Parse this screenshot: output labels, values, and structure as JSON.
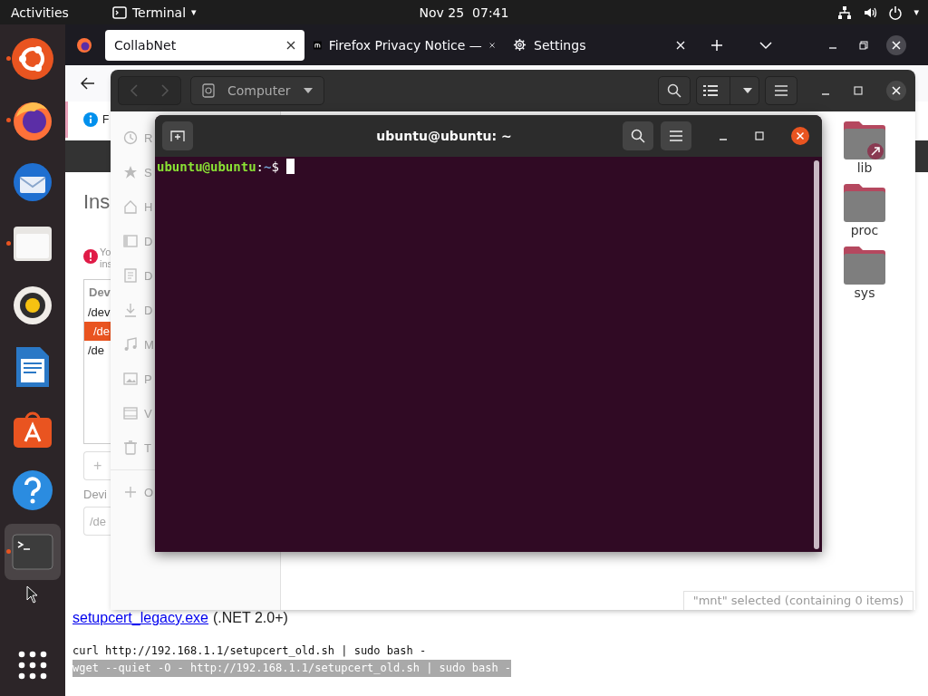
{
  "top_bar": {
    "activities": "Activities",
    "app_menu": "Terminal",
    "app_menu_caret": "▾",
    "clock": "Nov 25  07:41",
    "status_caret": "▾"
  },
  "dock": [
    {
      "kind": "ubuntu",
      "running": true,
      "selected": false
    },
    {
      "kind": "firefox",
      "running": true,
      "selected": false
    },
    {
      "kind": "thunderbird",
      "running": false,
      "selected": false
    },
    {
      "kind": "files",
      "running": true,
      "selected": false
    },
    {
      "kind": "rhythmbox",
      "running": false,
      "selected": false
    },
    {
      "kind": "writer",
      "running": false,
      "selected": false
    },
    {
      "kind": "store",
      "running": false,
      "selected": false
    },
    {
      "kind": "help",
      "running": false,
      "selected": false
    },
    {
      "kind": "terminal",
      "running": true,
      "selected": true
    }
  ],
  "browser": {
    "tabs": [
      {
        "kind": "plain",
        "label": "CollabNet",
        "selected": true
      },
      {
        "kind": "mozilla",
        "label": "Firefox Privacy Notice —",
        "selected": false
      },
      {
        "kind": "settings",
        "label": "Settings",
        "selected": false
      }
    ],
    "infobar_text": "F",
    "page": {
      "heading": "Ins",
      "alert_lines": [
        "Yo",
        "ins"
      ],
      "list_header": "Dev",
      "list_rows": [
        {
          "text": "/dev",
          "selected": false
        },
        {
          "text": "/de",
          "selected": true
        },
        {
          "text": "/de",
          "selected": false
        }
      ],
      "add_button": "+",
      "field_label": "Devi",
      "field_value": "/de",
      "download_link": "setupcert_legacy.exe",
      "download_note": "(.NET 2.0+)",
      "commands": [
        {
          "text": "curl http://192.168.1.1/setupcert_old.sh | sudo bash -",
          "highlighted": false
        },
        {
          "text": "wget --quiet -O - http://192.168.1.1/setupcert_old.sh | sudo bash -",
          "highlighted": true
        }
      ]
    }
  },
  "files": {
    "location": "Computer",
    "sidebar": [
      {
        "kind": "recent",
        "label": "R"
      },
      {
        "kind": "starred",
        "label": "S"
      },
      {
        "kind": "home",
        "label": "H"
      },
      {
        "kind": "desktop",
        "label": "D"
      },
      {
        "kind": "documents",
        "label": "D"
      },
      {
        "kind": "downloads",
        "label": "D"
      },
      {
        "kind": "music",
        "label": "M"
      },
      {
        "kind": "pictures",
        "label": "P"
      },
      {
        "kind": "videos",
        "label": "V"
      },
      {
        "kind": "trash",
        "label": "T"
      },
      {
        "kind": "other",
        "label": "O"
      }
    ],
    "folders": [
      {
        "name": "lib",
        "link": true
      },
      {
        "name": "proc",
        "link": false
      },
      {
        "name": "sys",
        "link": false
      }
    ],
    "status": "\"mnt\" selected  (containing 0 items)"
  },
  "terminal": {
    "title": "ubuntu@ubuntu: ~",
    "user_host": "ubuntu@ubuntu",
    "colon": ":",
    "path": "~",
    "prompt": "$"
  }
}
